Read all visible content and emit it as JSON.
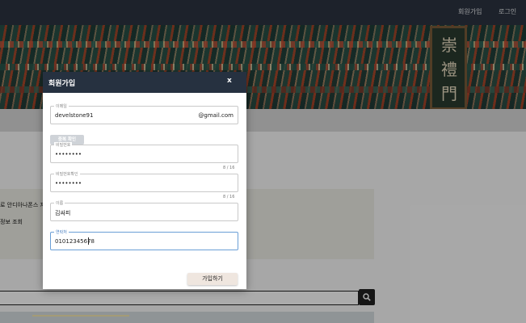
{
  "nav": {
    "signup": "회원가입",
    "login": "로그인"
  },
  "banner": {
    "plaque_glyphs": [
      "崇",
      "禮",
      "門"
    ]
  },
  "background": {
    "info_line1": "로 안디아나폰스 지하",
    "info_line2": "정보 조회"
  },
  "modal": {
    "title": "회원가입",
    "close": "x",
    "email": {
      "label": "이메일",
      "value": "develstone91",
      "suffix": "@gmail.com"
    },
    "verify_button": "중복 확인",
    "password": {
      "label": "비밀번호",
      "value": "••••••••",
      "counter": "8 / 16"
    },
    "password_confirm": {
      "label": "비밀번호확인",
      "value": "••••••••",
      "counter": "8 / 16"
    },
    "name": {
      "label": "이름",
      "value": "김싸피"
    },
    "phone": {
      "label": "연락처",
      "value": "01012345678"
    },
    "submit": "가입하기"
  },
  "colors": {
    "header": "#263140",
    "nav": "#2c3440",
    "focus": "#6b9fd6",
    "submit_bg": "#efe6df"
  }
}
